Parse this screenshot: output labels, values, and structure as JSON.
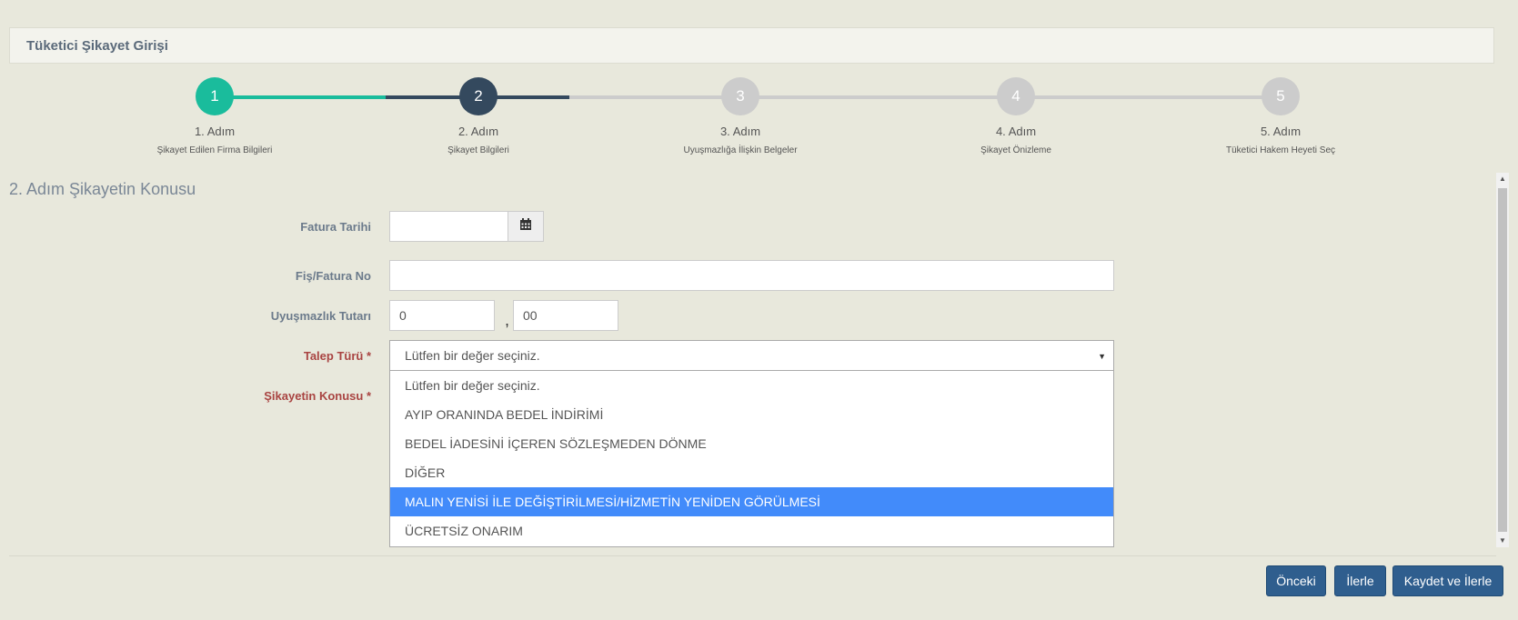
{
  "header": {
    "title": "Tüketici Şikayet Girişi"
  },
  "wizard": {
    "steps": [
      {
        "number": "1",
        "title": "1. Adım",
        "desc": "Şikayet Edilen Firma Bilgileri"
      },
      {
        "number": "2",
        "title": "2. Adım",
        "desc": "Şikayet Bilgileri"
      },
      {
        "number": "3",
        "title": "3. Adım",
        "desc": "Uyuşmazlığa İlişkin Belgeler"
      },
      {
        "number": "4",
        "title": "4. Adım",
        "desc": "Şikayet Önizleme"
      },
      {
        "number": "5",
        "title": "5. Adım",
        "desc": "Tüketici Hakem Heyeti Seç"
      }
    ],
    "colors": {
      "done": "#1abc9c",
      "current": "#34495e",
      "pending": "#cccccc"
    }
  },
  "form": {
    "section_title": "2. Adım Şikayetin Konusu",
    "fatura_tarihi_label": "Fatura Tarihi",
    "fatura_tarihi_value": "",
    "fis_no_label": "Fiş/Fatura No",
    "fis_no_value": "",
    "tutar_label": "Uyuşmazlık Tutarı",
    "tutar_int": "0",
    "tutar_sep": ",",
    "tutar_dec": "00",
    "talep_label": "Talep Türü *",
    "talep_value": "Lütfen bir değer seçiniz.",
    "konu_label": "Şikayetin Konusu *"
  },
  "dropdown": {
    "options": [
      "Lütfen bir değer seçiniz.",
      "AYIP ORANINDA BEDEL İNDİRİMİ",
      "BEDEL İADESİNİ İÇEREN SÖZLEŞMEDEN DÖNME",
      "DİĞER",
      "MALIN YENİSİ İLE DEĞİŞTİRİLMESİ/HİZMETİN YENİDEN GÖRÜLMESİ",
      "ÜCRETSİZ ONARIM"
    ],
    "highlighted_index": 4
  },
  "buttons": {
    "prev": "Önceki",
    "next": "İlerle",
    "save_next": "Kaydet ve İlerle"
  },
  "icons": {
    "calendar": "calendar-icon",
    "caret": "caret-down-icon"
  }
}
